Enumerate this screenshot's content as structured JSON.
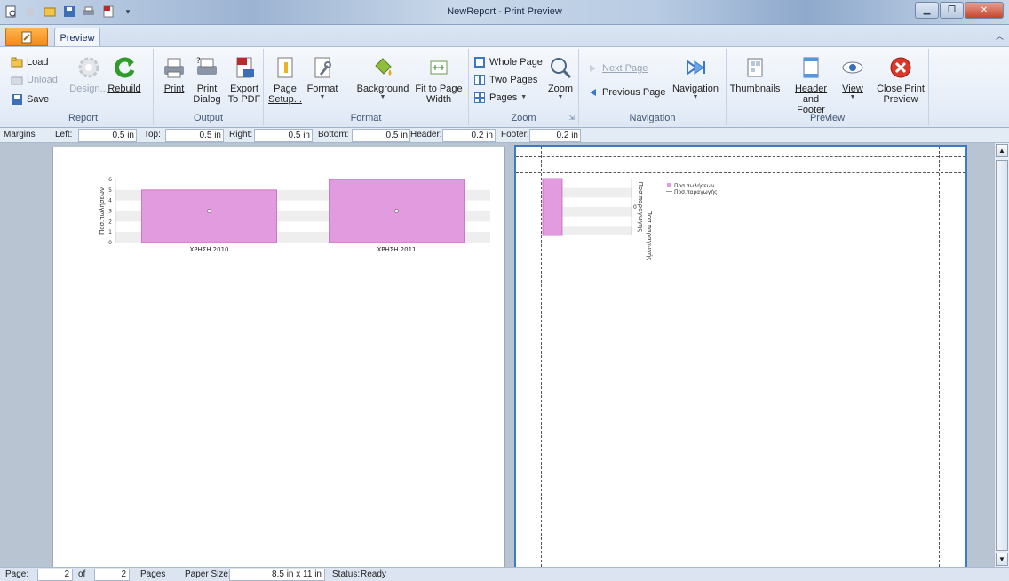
{
  "window": {
    "title": "NewReport - Print Preview"
  },
  "tabs": {
    "preview": "Preview"
  },
  "ribbon": {
    "report": {
      "label": "Report",
      "load": "Load",
      "unload": "Unload",
      "save": "Save",
      "design": "Design...",
      "rebuild": "Rebuild"
    },
    "output": {
      "label": "Output",
      "print": "Print",
      "print_dialog_line1": "Print",
      "print_dialog_line2": "Dialog",
      "export_line1": "Export",
      "export_line2": "To PDF"
    },
    "format": {
      "label": "Format",
      "page_setup_line1": "Page",
      "page_setup_line2": "Setup...",
      "format": "Format",
      "background": "Background",
      "fit_line1": "Fit to Page",
      "fit_line2": "Width"
    },
    "zoom": {
      "label": "Zoom",
      "whole_page": "Whole Page",
      "two_pages": "Two Pages",
      "pages": "Pages",
      "zoom": "Zoom"
    },
    "navigation": {
      "label": "Navigation",
      "next_page": "Next Page",
      "previous_page": "Previous Page",
      "navigation": "Navigation"
    },
    "preview": {
      "label": "Preview",
      "thumbnails": "Thumbnails",
      "header_footer_line1": "Header",
      "header_footer_line2": "and Footer",
      "view": "View",
      "close_line1": "Close Print",
      "close_line2": "Preview"
    }
  },
  "margins": {
    "label": "Margins",
    "left_label": "Left:",
    "left": "0.5 in",
    "top_label": "Top:",
    "top": "0.5 in",
    "right_label": "Right:",
    "right": "0.5 in",
    "bottom_label": "Bottom:",
    "bottom": "0.5 in",
    "header_label": "Header:",
    "header": "0.2 in",
    "footer_label": "Footer:",
    "footer": "0.2 in"
  },
  "page1_chart": {
    "ylabel": "Ποσ.πωλήσεων",
    "yticks": [
      "0",
      "1",
      "2",
      "3",
      "4",
      "5",
      "6"
    ],
    "categories": [
      "ΧΡΗΣΗ 2010",
      "ΧΡΗΣΗ 2011"
    ]
  },
  "page2_chart": {
    "axis_label_top": "Ποσ.παραγωγής",
    "axis_label_bottom": "Ποσ.παραγωγής",
    "tick": "0",
    "legend": [
      "Ποσ.πωλήσεων",
      "Ποσ.παραγωγής"
    ]
  },
  "chart_data": {
    "type": "bar",
    "categories": [
      "ΧΡΗΣΗ 2010",
      "ΧΡΗΣΗ 2011"
    ],
    "ylim": [
      0,
      6
    ],
    "series": [
      {
        "name": "Ποσ.πωλήσεων",
        "type": "bar",
        "values": [
          5,
          6
        ],
        "color": "#e39be0"
      },
      {
        "name": "Ποσ.παραγωγής",
        "type": "line",
        "values": [
          3,
          3
        ],
        "color": "#999999"
      }
    ]
  },
  "status": {
    "page_label": "Page:",
    "page": "2",
    "of_label": "of",
    "total": "2",
    "pages_label": "Pages",
    "paper_label": "Paper Size:",
    "paper": "8.5 in x 11 in",
    "status_label": "Status:",
    "status": "Ready"
  },
  "colors": {
    "bar": "#e39be0",
    "bar_border": "#c561c2",
    "line": "#999999",
    "accent": "#3c79c7"
  }
}
